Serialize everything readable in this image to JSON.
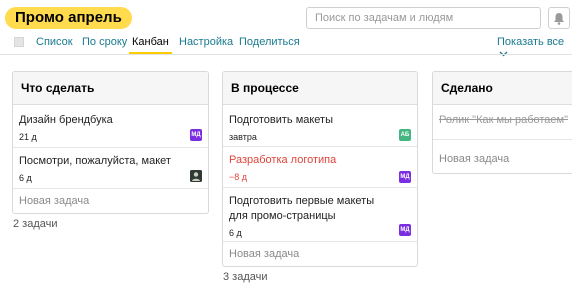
{
  "header": {
    "project_title": "Промо апрель",
    "search_placeholder": "Поиск по задачам и людям"
  },
  "tabs": [
    {
      "label": "Список"
    },
    {
      "label": "По сроку"
    },
    {
      "label": "Канбан",
      "active": true
    },
    {
      "label": "Настройка"
    },
    {
      "label": "Поделиться"
    }
  ],
  "show_all_label": "Показать все",
  "columns": [
    {
      "title": "Что сделать",
      "cards": [
        {
          "title": "Дизайн брендбука",
          "due": "21 д",
          "badge": "МД",
          "badge_color": "#7b2ee0"
        },
        {
          "title": "Посмотри, пожалуйста, макет",
          "due": "6 д",
          "badge": "",
          "badge_color": "#3a4a3a"
        }
      ],
      "new_task_label": "Новая задача",
      "count_label": "2 задачи"
    },
    {
      "title": "В процессе",
      "cards": [
        {
          "title": "Подготовить макеты",
          "due": "завтра",
          "badge": "АБ",
          "badge_color": "#43b581"
        },
        {
          "title": "Разработка логотипа",
          "due": "−8 д",
          "badge": "МД",
          "badge_color": "#7b2ee0",
          "overdue": true
        },
        {
          "title": "Подготовить первые макеты для промо-страницы",
          "due": "6 д",
          "badge": "МД",
          "badge_color": "#7b2ee0"
        }
      ],
      "new_task_label": "Новая задача",
      "count_label": "3 задачи"
    },
    {
      "title": "Сделано",
      "cards": [
        {
          "title": "Ролик \"Как мы работаем\"",
          "done": true
        }
      ],
      "new_task_label": "Новая задача"
    }
  ]
}
